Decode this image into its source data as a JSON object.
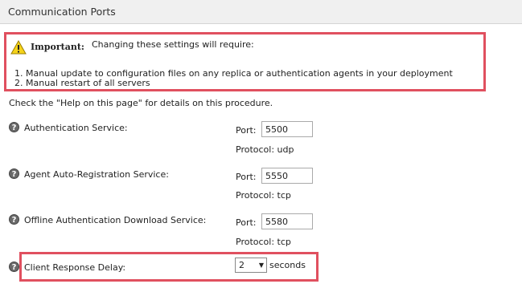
{
  "header": {
    "title": "Communication Ports"
  },
  "important": {
    "label": "Important:",
    "text": "Changing these settings will require:",
    "items": [
      "1.  Manual update to configuration files on any replica or authentication agents in your deployment",
      "2.  Manual restart of all servers"
    ]
  },
  "help_note": "Check the \"Help on this page\" for details on this procedure.",
  "services": [
    {
      "label": "Authentication Service:",
      "port_label": "Port:",
      "port": "5500",
      "protocol": "Protocol: udp"
    },
    {
      "label": "Agent Auto-Registration Service:",
      "port_label": "Port:",
      "port": "5550",
      "protocol": "Protocol: tcp"
    },
    {
      "label": "Offline Authentication Download Service:",
      "port_label": "Port:",
      "port": "5580",
      "protocol": "Protocol: tcp"
    }
  ],
  "client_delay": {
    "label": "Client Response Delay:",
    "selected": "2",
    "unit": "seconds"
  },
  "icons": {
    "warning": "warning-icon",
    "help": "help-icon"
  },
  "colors": {
    "highlight": "#e0505f",
    "header_bg": "#f0f0f0"
  }
}
